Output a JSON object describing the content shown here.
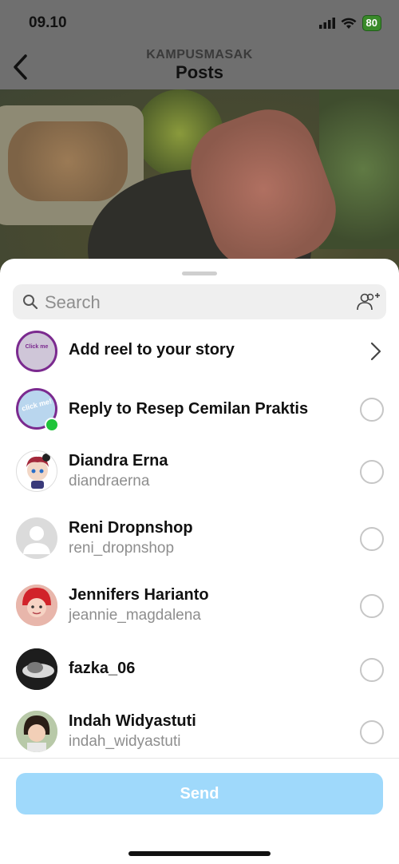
{
  "status_bar": {
    "time": "09.10",
    "battery": "80"
  },
  "header": {
    "account": "KAMPUSMASAK",
    "title": "Posts"
  },
  "search": {
    "placeholder": "Search"
  },
  "story_option": {
    "label": "Add reel to your story",
    "avatar_text": "Click me"
  },
  "reply_option": {
    "label": "Reply to Resep Cemilan Praktis",
    "avatar_text": "click me!"
  },
  "contacts": [
    {
      "name": "Diandra Erna",
      "username": "diandraerna"
    },
    {
      "name": "Reni Dropnshop",
      "username": "reni_dropnshop"
    },
    {
      "name": "Jennifers Harianto",
      "username": "jeannie_magdalena"
    },
    {
      "name": "fazka_06",
      "username": ""
    },
    {
      "name": "Indah Widyastuti",
      "username": "indah_widyastuti"
    }
  ],
  "send_button": {
    "label": "Send"
  },
  "colors": {
    "send": "#9fd9fb",
    "online": "#1fc43a",
    "brand_ring": "#7b2a8f"
  },
  "icons": [
    "back-chevron-icon",
    "search-icon",
    "add-people-icon",
    "chevron-right-icon",
    "signal-icon",
    "wifi-icon",
    "battery-icon"
  ]
}
